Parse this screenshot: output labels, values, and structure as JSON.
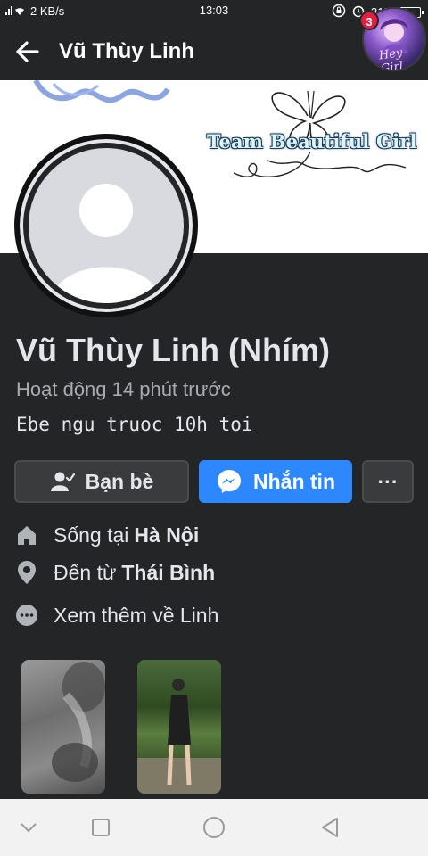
{
  "status_bar": {
    "signal": "4G",
    "speed": "2 KB/s",
    "time": "13:03",
    "battery": "31%",
    "battery_level": 0.31
  },
  "header": {
    "title": "Vũ Thùy Linh",
    "notification_count": "3",
    "avatar_text": "Hey Girl"
  },
  "cover": {
    "text": "Team Beautiful Girl"
  },
  "profile": {
    "name": "Vũ Thùy Linh (Nhím)",
    "active_status": "Hoạt động 14 phút trước",
    "bio": "Ebe ngu truoc 10h toi"
  },
  "actions": {
    "friends_label": "Bạn bè",
    "message_label": "Nhắn tin",
    "more_label": "···"
  },
  "details": {
    "lives_prefix": "Sống tại",
    "lives_city": "Hà Nội",
    "from_prefix": "Đến từ",
    "from_city": "Thái Bình",
    "see_more": "Xem thêm về Linh"
  },
  "colors": {
    "background": "#242526",
    "accent": "#2d88ff",
    "badge": "#e41e3f"
  }
}
